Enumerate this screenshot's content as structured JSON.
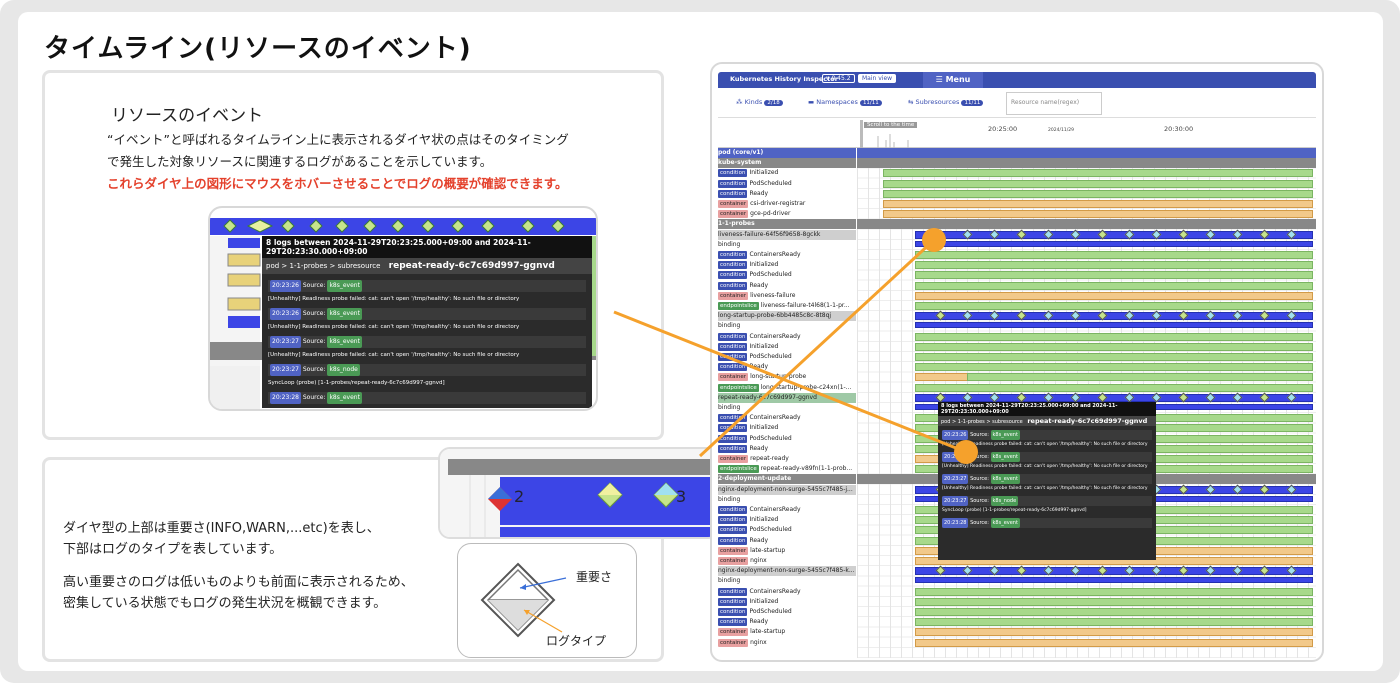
{
  "page": {
    "title": "タイムライン(リソースのイベント)"
  },
  "card1": {
    "heading": "リソースのイベント",
    "line1": "“イベント”と呼ばれるタイムライン上に表示されるダイヤ状の点はそのタイミング",
    "line2": "で発生した対象リソースに関連するログがあることを示しています。",
    "line3_red": "これらダイヤ上の図形にマウスをホバーさせることでログの概要が確認できます。"
  },
  "card2": {
    "p1_line1": "ダイヤ型の上部は重要さ(INFO,WARN,...etc)を表し、",
    "p1_line2": "下部はログのタイプを表しています。",
    "p2_line1": "高い重要さのログは低いものよりも前面に表示されるため、",
    "p2_line2": "密集している状態でもログの発生状況を概観できます。",
    "label_importance": "重要さ",
    "label_logtype": "ログタイプ"
  },
  "popup_small": {
    "header": "8 logs between 2024-11-29T20:23:25.000+09:00 and 2024-11-29T20:23:30.000+09:00",
    "path": "pod > 1-1-probes > subresource",
    "resource": "repeat-ready-6c7c69d997-ggnvd",
    "entries": [
      {
        "time": "20:23:26",
        "source_label": "Source:",
        "source": "k8s_event",
        "msg": "[Unhealthy] Readiness probe failed: cat: can't open '/tmp/healthy': No such file or directory"
      },
      {
        "time": "20:23:26",
        "source_label": "Source:",
        "source": "k8s_event",
        "msg": "[Unhealthy] Readiness probe failed: cat: can't open '/tmp/healthy': No such file or directory"
      },
      {
        "time": "20:23:27",
        "source_label": "Source:",
        "source": "k8s_event",
        "msg": "[Unhealthy] Readiness probe failed: cat: can't open '/tmp/healthy': No such file or directory"
      },
      {
        "time": "20:23:27",
        "source_label": "Source:",
        "source": "k8s_node",
        "msg": "SyncLoop (probe) [1-1-probes/repeat-ready-6c7c69d997-ggnvd]"
      },
      {
        "time": "20:23:28",
        "source_label": "Source:",
        "source": "k8s_event",
        "msg": ""
      }
    ]
  },
  "zoom": {
    "num_left": "2",
    "num_right": "3"
  },
  "app": {
    "title": "Kubernetes History Inspector",
    "version": "v 0.45.2",
    "main_view": "Main view",
    "menu": "☰ Menu",
    "filter_kinds": "Kinds",
    "filter_kinds_badge": "2/18",
    "filter_namespaces": "Namespaces",
    "filter_namespaces_badge": "11/11",
    "filter_subresources": "Subresources",
    "filter_subresources_badge": "11/11",
    "search_placeholder": "Resource name(regex)",
    "scroll_label": "Scroll to the time",
    "time1": "20:25:00",
    "date1": "2024/11/29",
    "time2": "20:30:00",
    "rows": [
      {
        "kind": "hdr2",
        "text": "pod (core/v1)"
      },
      {
        "kind": "hdr",
        "text": "kube-system"
      },
      {
        "kind": "cond",
        "tag": "condition",
        "text": "Initialized"
      },
      {
        "kind": "cond",
        "tag": "condition",
        "text": "PodScheduled"
      },
      {
        "kind": "cond",
        "tag": "condition",
        "text": "Ready"
      },
      {
        "kind": "cont",
        "tag": "container",
        "text": "csi-driver-registrar"
      },
      {
        "kind": "cont",
        "tag": "container",
        "text": "gce-pd-driver"
      },
      {
        "kind": "hdr",
        "text": "1-1-probes"
      },
      {
        "kind": "grp",
        "text": "liveness-failure-64f56f9658-8gckk"
      },
      {
        "kind": "plain",
        "text": "binding"
      },
      {
        "kind": "cond",
        "tag": "condition",
        "text": "ContainersReady"
      },
      {
        "kind": "cond",
        "tag": "condition",
        "text": "Initialized"
      },
      {
        "kind": "cond",
        "tag": "condition",
        "text": "PodScheduled"
      },
      {
        "kind": "cond",
        "tag": "condition",
        "text": "Ready"
      },
      {
        "kind": "cont",
        "tag": "container",
        "text": "liveness-failure"
      },
      {
        "kind": "endp",
        "tag": "endpointslice",
        "text": "liveness-failure-t4l68(1-1-pr..."
      },
      {
        "kind": "grp",
        "text": "long-startup-probe-6bb4485c8c-8t8qj"
      },
      {
        "kind": "plain",
        "text": "binding"
      },
      {
        "kind": "cond",
        "tag": "condition",
        "text": "ContainersReady"
      },
      {
        "kind": "cond",
        "tag": "condition",
        "text": "Initialized"
      },
      {
        "kind": "cond",
        "tag": "condition",
        "text": "PodScheduled"
      },
      {
        "kind": "cond",
        "tag": "condition",
        "text": "Ready"
      },
      {
        "kind": "cont",
        "tag": "container",
        "text": "long-startup-probe"
      },
      {
        "kind": "endp",
        "tag": "endpointslice",
        "text": "long-startup-probe-c24xn(1-..."
      },
      {
        "kind": "sel",
        "text": "repeat-ready-6c7c69d997-ggnvd"
      },
      {
        "kind": "plain",
        "text": "binding"
      },
      {
        "kind": "cond",
        "tag": "condition",
        "text": "ContainersReady"
      },
      {
        "kind": "cond",
        "tag": "condition",
        "text": "Initialized"
      },
      {
        "kind": "cond",
        "tag": "condition",
        "text": "PodScheduled"
      },
      {
        "kind": "cond",
        "tag": "condition",
        "text": "Ready"
      },
      {
        "kind": "cont",
        "tag": "container",
        "text": "repeat-ready"
      },
      {
        "kind": "endp",
        "tag": "endpointslice",
        "text": "repeat-ready-v89fn(1-1-prob..."
      },
      {
        "kind": "hdr",
        "text": "2-deployment-update"
      },
      {
        "kind": "grp",
        "text": "nginx-deployment-non-surge-5455c7f485-j..."
      },
      {
        "kind": "plain",
        "text": "binding"
      },
      {
        "kind": "cond",
        "tag": "condition",
        "text": "ContainersReady"
      },
      {
        "kind": "cond",
        "tag": "condition",
        "text": "Initialized"
      },
      {
        "kind": "cond",
        "tag": "condition",
        "text": "PodScheduled"
      },
      {
        "kind": "cond",
        "tag": "condition",
        "text": "Ready"
      },
      {
        "kind": "cont",
        "tag": "container",
        "text": "late-startup"
      },
      {
        "kind": "cont",
        "tag": "container",
        "text": "nginx"
      },
      {
        "kind": "grp",
        "text": "nginx-deployment-non-surge-5455c7f485-k..."
      },
      {
        "kind": "plain",
        "text": "binding"
      },
      {
        "kind": "cond",
        "tag": "condition",
        "text": "ContainersReady"
      },
      {
        "kind": "cond",
        "tag": "condition",
        "text": "Initialized"
      },
      {
        "kind": "cond",
        "tag": "condition",
        "text": "PodScheduled"
      },
      {
        "kind": "cond",
        "tag": "condition",
        "text": "Ready"
      },
      {
        "kind": "cont",
        "tag": "container",
        "text": "late-startup"
      },
      {
        "kind": "cont",
        "tag": "container",
        "text": "nginx"
      }
    ],
    "popup": {
      "header": "8 logs between 2024-11-29T20:23:25.000+09:00 and 2024-11-29T20:23:30.000+09:00",
      "path": "pod > 1-1-probes > subresource",
      "resource": "repeat-ready-6c7c69d997-ggnvd"
    }
  },
  "colors": {
    "accent": "#f5a12c",
    "highlight_red": "#e4412c",
    "brand_blue": "#3a4fb0"
  }
}
